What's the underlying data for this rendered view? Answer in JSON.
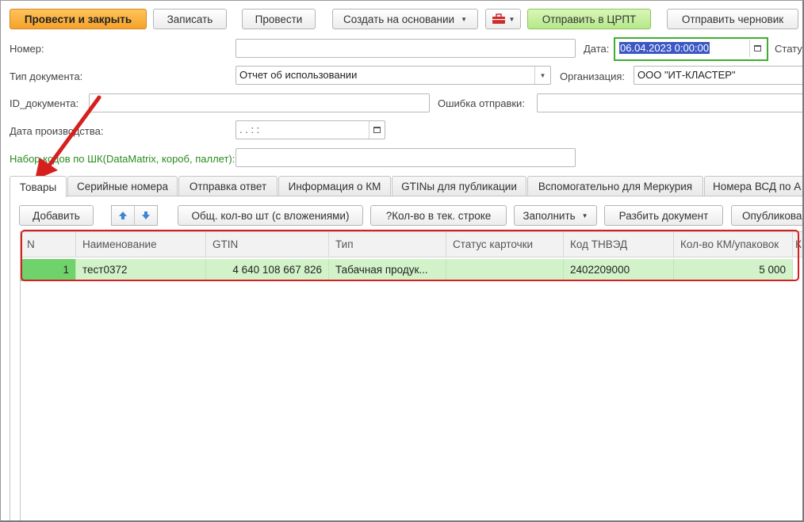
{
  "toolbar": {
    "post_close": "Провести и закрыть",
    "save": "Записать",
    "post": "Провести",
    "create_based": "Создать на основании",
    "send_crpt": "Отправить в ЦРПТ",
    "send_draft": "Отправить черновик"
  },
  "form": {
    "number_label": "Номер:",
    "number_value": "",
    "date_label": "Дата:",
    "date_value": "06.04.2023  0:00:00",
    "status_label": "Стату",
    "doc_type_label": "Тип документа:",
    "doc_type_value": "Отчет об использовании",
    "org_label": "Организация:",
    "org_value": "ООО \"ИТ-КЛАСТЕР\"",
    "doc_id_label": "ID_документа:",
    "doc_id_value": "",
    "send_error_label": "Ошибка отправки:",
    "send_error_value": "",
    "prod_date_label": "Дата производства:",
    "prod_date_value": " .  .      :  :",
    "barcode_label": "Набор кодов по ШК(DataMatrix, короб, паллет):",
    "barcode_value": ""
  },
  "tabs": [
    {
      "label": "Товары"
    },
    {
      "label": "Серийные номера"
    },
    {
      "label": "Отправка ответ"
    },
    {
      "label": "Информация о КМ"
    },
    {
      "label": "GTINы для публикации"
    },
    {
      "label": "Вспомогательно для Меркурия"
    },
    {
      "label": "Номера ВСД по А"
    }
  ],
  "panel_toolbar": {
    "add": "Добавить",
    "total_qty": "Общ. кол-во шт (с вложениями)",
    "qty_row": "?Кол-во в тек. строке",
    "fill": "Заполнить",
    "split": "Разбить документ",
    "publish": "Опубликова"
  },
  "table": {
    "columns": [
      "N",
      "Наименование",
      "GTIN",
      "Тип",
      "Статус карточки",
      "Код ТНВЭД",
      "Кол-во КМ/упаковок",
      "К"
    ],
    "rows": [
      {
        "n": "1",
        "name": "тест0372",
        "gtin": "4 640 108 667 826",
        "type": "Табачная продук...",
        "status": "",
        "tnved": "2402209000",
        "qty": "5 000"
      }
    ]
  },
  "colors": {
    "accent_orange": "#f5a22a",
    "green_button": "#b5e88a",
    "row_highlight": "#d2f3c9",
    "annotation_red": "#d62020"
  }
}
